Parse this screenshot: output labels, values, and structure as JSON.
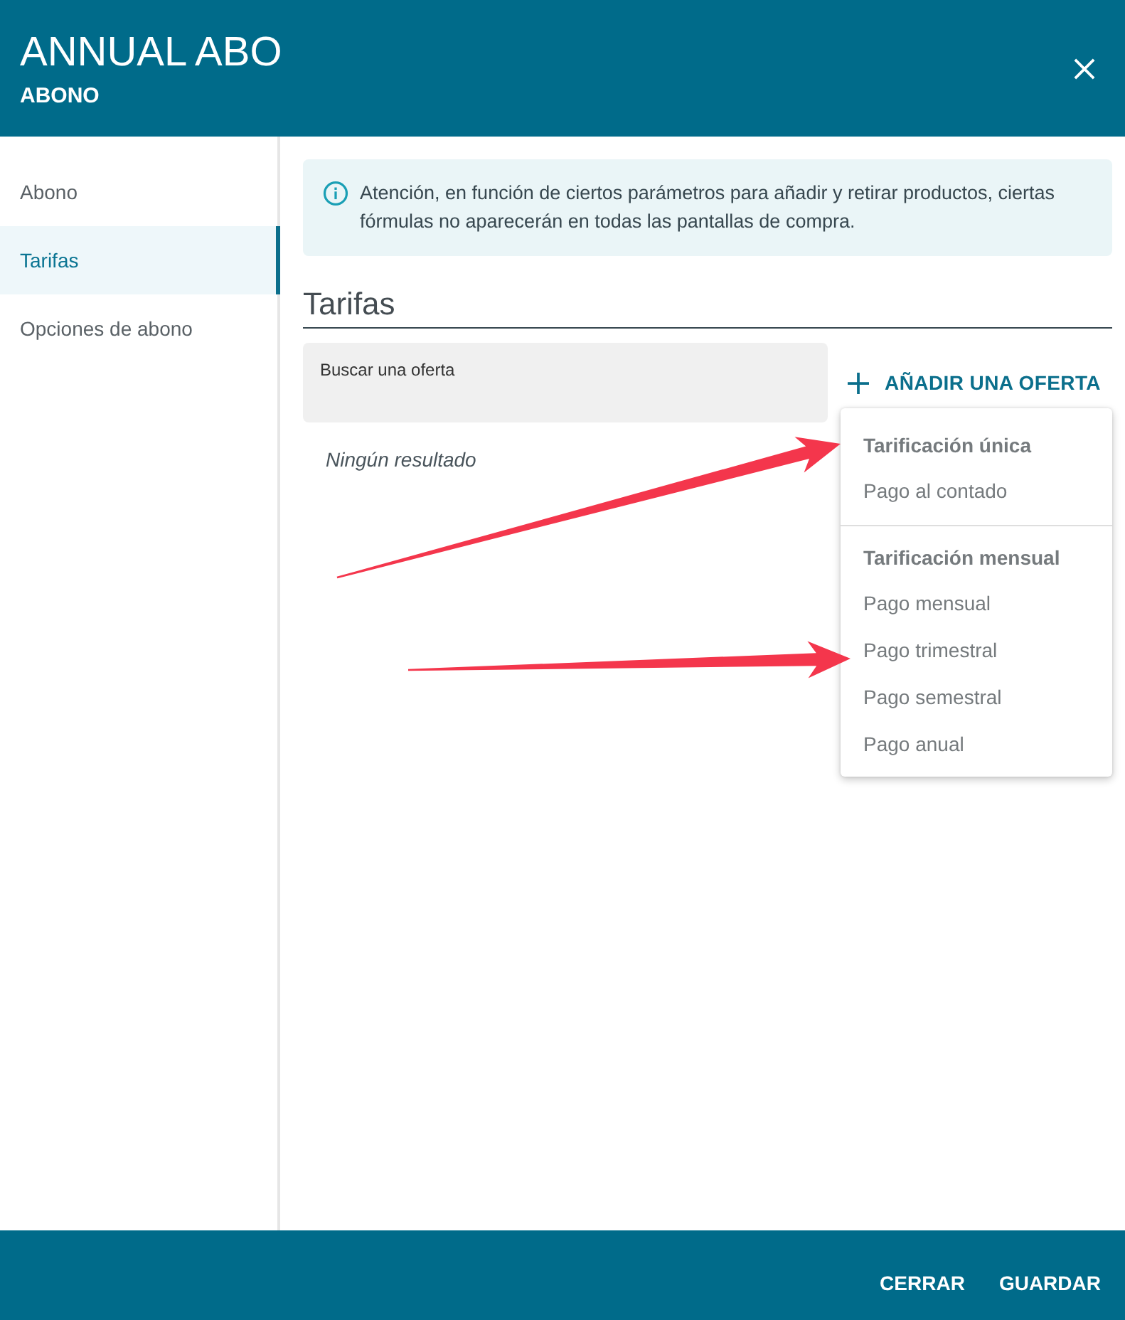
{
  "header": {
    "title": "ANNUAL ABO",
    "subtitle": "ABONO"
  },
  "sidebar": {
    "items": [
      {
        "label": "Abono",
        "selected": false
      },
      {
        "label": "Tarifas",
        "selected": true
      },
      {
        "label": "Opciones de abono",
        "selected": false
      }
    ]
  },
  "notice": {
    "text": "Atención, en función de ciertos parámetros para añadir y retirar productos, ciertas fórmulas no aparecerán en todas las pantallas de compra."
  },
  "section": {
    "title": "Tarifas"
  },
  "search": {
    "label": "Buscar una oferta"
  },
  "add_button": {
    "label": "AÑADIR UNA OFERTA"
  },
  "empty_message": "Ningún resultado",
  "menu": {
    "groups": [
      {
        "heading": "Tarificación única",
        "items": [
          "Pago al contado"
        ]
      },
      {
        "heading": "Tarificación mensual",
        "items": [
          "Pago mensual",
          "Pago trimestral",
          "Pago semestral",
          "Pago anual"
        ]
      }
    ]
  },
  "annotations": [
    {
      "kind": "arrow"
    },
    {
      "kind": "arrow"
    }
  ],
  "footer": {
    "buttons": [
      "CERRAR",
      "GUARDAR"
    ]
  }
}
